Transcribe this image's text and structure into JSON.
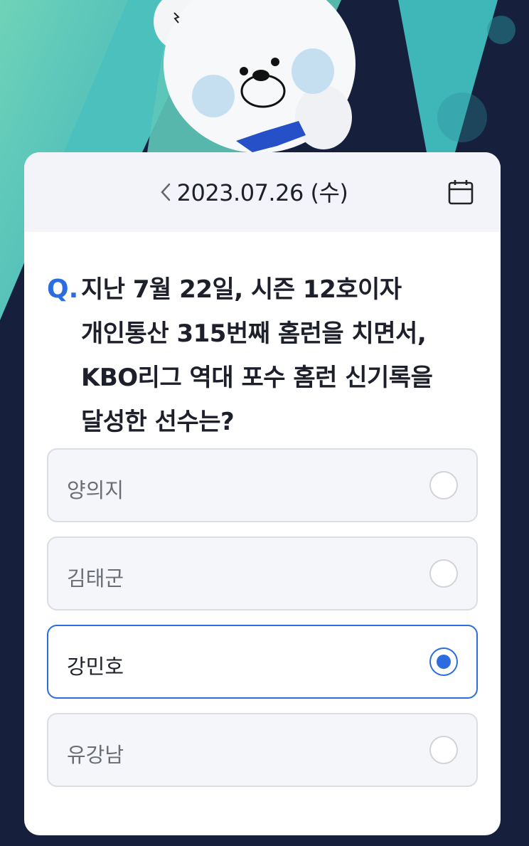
{
  "header": {
    "date": "2023.07.26 (수)",
    "prev_icon": "chevron-left-icon",
    "calendar_icon": "calendar-icon"
  },
  "question": {
    "marker": "Q.",
    "text": "지난 7월 22일, 시즌 12호이자 개인통산 315번째 홈런을 치면서, KBO리그 역대 포수 홈런 신기록을 달성한 선수는?"
  },
  "options": [
    {
      "label": "양의지",
      "selected": false
    },
    {
      "label": "김태군",
      "selected": false
    },
    {
      "label": "강민호",
      "selected": true
    },
    {
      "label": "유강남",
      "selected": false
    }
  ],
  "colors": {
    "accent": "#2b6ddf",
    "background_dark": "#16203d",
    "background_teal": "#5ec8b8"
  }
}
